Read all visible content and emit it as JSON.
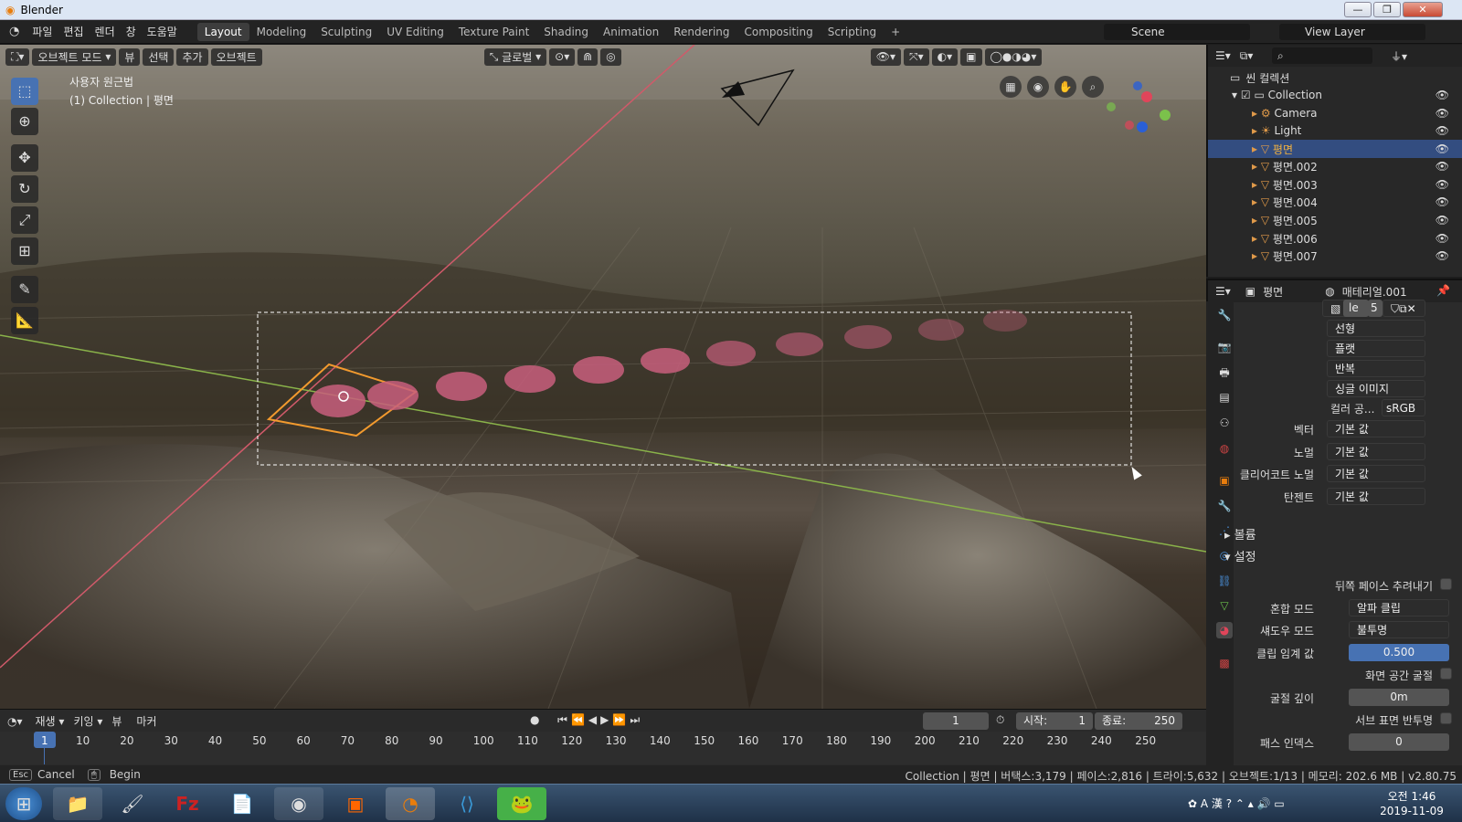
{
  "window": {
    "title": "Blender",
    "min": "—",
    "max": "❐",
    "close": "✕"
  },
  "menus": [
    "파일",
    "편집",
    "렌더",
    "창",
    "도움말"
  ],
  "workspaces": [
    "Layout",
    "Modeling",
    "Sculpting",
    "UV Editing",
    "Texture Paint",
    "Shading",
    "Animation",
    "Rendering",
    "Compositing",
    "Scripting",
    "+"
  ],
  "scene": {
    "label": "Scene",
    "view_layer": "View Layer"
  },
  "viewport": {
    "mode": "오브젝트 모드",
    "view": "뷰",
    "select": "선택",
    "add": "추가",
    "object": "오브젝트",
    "orientation": "글로벌",
    "overlay_title": "사용자 원근법",
    "overlay_sub": "(1) Collection | 평면"
  },
  "outliner": {
    "root": "씬 컬렉션",
    "collection": "Collection",
    "items": [
      "Camera",
      "Light",
      "평면",
      "평면.002",
      "평면.003",
      "평면.004",
      "평면.005",
      "평면.006",
      "평면.007"
    ]
  },
  "properties": {
    "object": "평면",
    "material": "매테리얼.001",
    "image_short": "le",
    "user_count": "5",
    "interp": "선형",
    "proj": "플랫",
    "ext": "반복",
    "source": "싱글 이미지",
    "color_space_label": "컬러 공...",
    "color_space": "sRGB",
    "vector_label": "벡터",
    "vector": "기본 값",
    "normal_label": "노멀",
    "normal": "기본 값",
    "clearcoat_label": "클리어코트 노멀",
    "clearcoat": "기본 값",
    "tangent_label": "탄젠트",
    "tangent": "기본 값",
    "volume": "볼륨",
    "settings": "설정",
    "backface": "뒤쪽 페이스 추려내기",
    "blend_label": "혼합 모드",
    "blend": "알파 클립",
    "shadow_label": "섀도우 모드",
    "shadow": "불투명",
    "clip_label": "클립 임계 값",
    "clip": "0.500",
    "ssr": "화면 공간 굴절",
    "refr_label": "굴절 깊이",
    "refr": "0m",
    "sss": "서브 표면 반투명",
    "pass_label": "패스 인덱스",
    "pass": "0"
  },
  "timeline": {
    "play": "재생",
    "keying": "키잉",
    "view": "뷰",
    "marker": "마커",
    "current": "1",
    "start_label": "시작:",
    "start": "1",
    "end_label": "종료:",
    "end": "250",
    "ticks": [
      "1",
      "10",
      "20",
      "30",
      "40",
      "50",
      "60",
      "70",
      "80",
      "90",
      "100",
      "110",
      "120",
      "130",
      "140",
      "150",
      "160",
      "170",
      "180",
      "190",
      "200",
      "210",
      "220",
      "230",
      "240",
      "250"
    ]
  },
  "status": {
    "cancel": "Cancel",
    "begin": "Begin",
    "info": "Collection | 평면 | 버택스:3,179 | 페이스:2,816 | 트라이:5,632 | 오브젝트:1/13 | 메모리: 202.6 MB | v2.80.75"
  },
  "taskbar": {
    "time": "오전 1:46",
    "date": "2019-11-09",
    "apps": [
      "start",
      "explorer",
      "paint",
      "filezilla",
      "notepad",
      "chrome",
      "live",
      "blender",
      "vscode",
      "frog"
    ]
  }
}
